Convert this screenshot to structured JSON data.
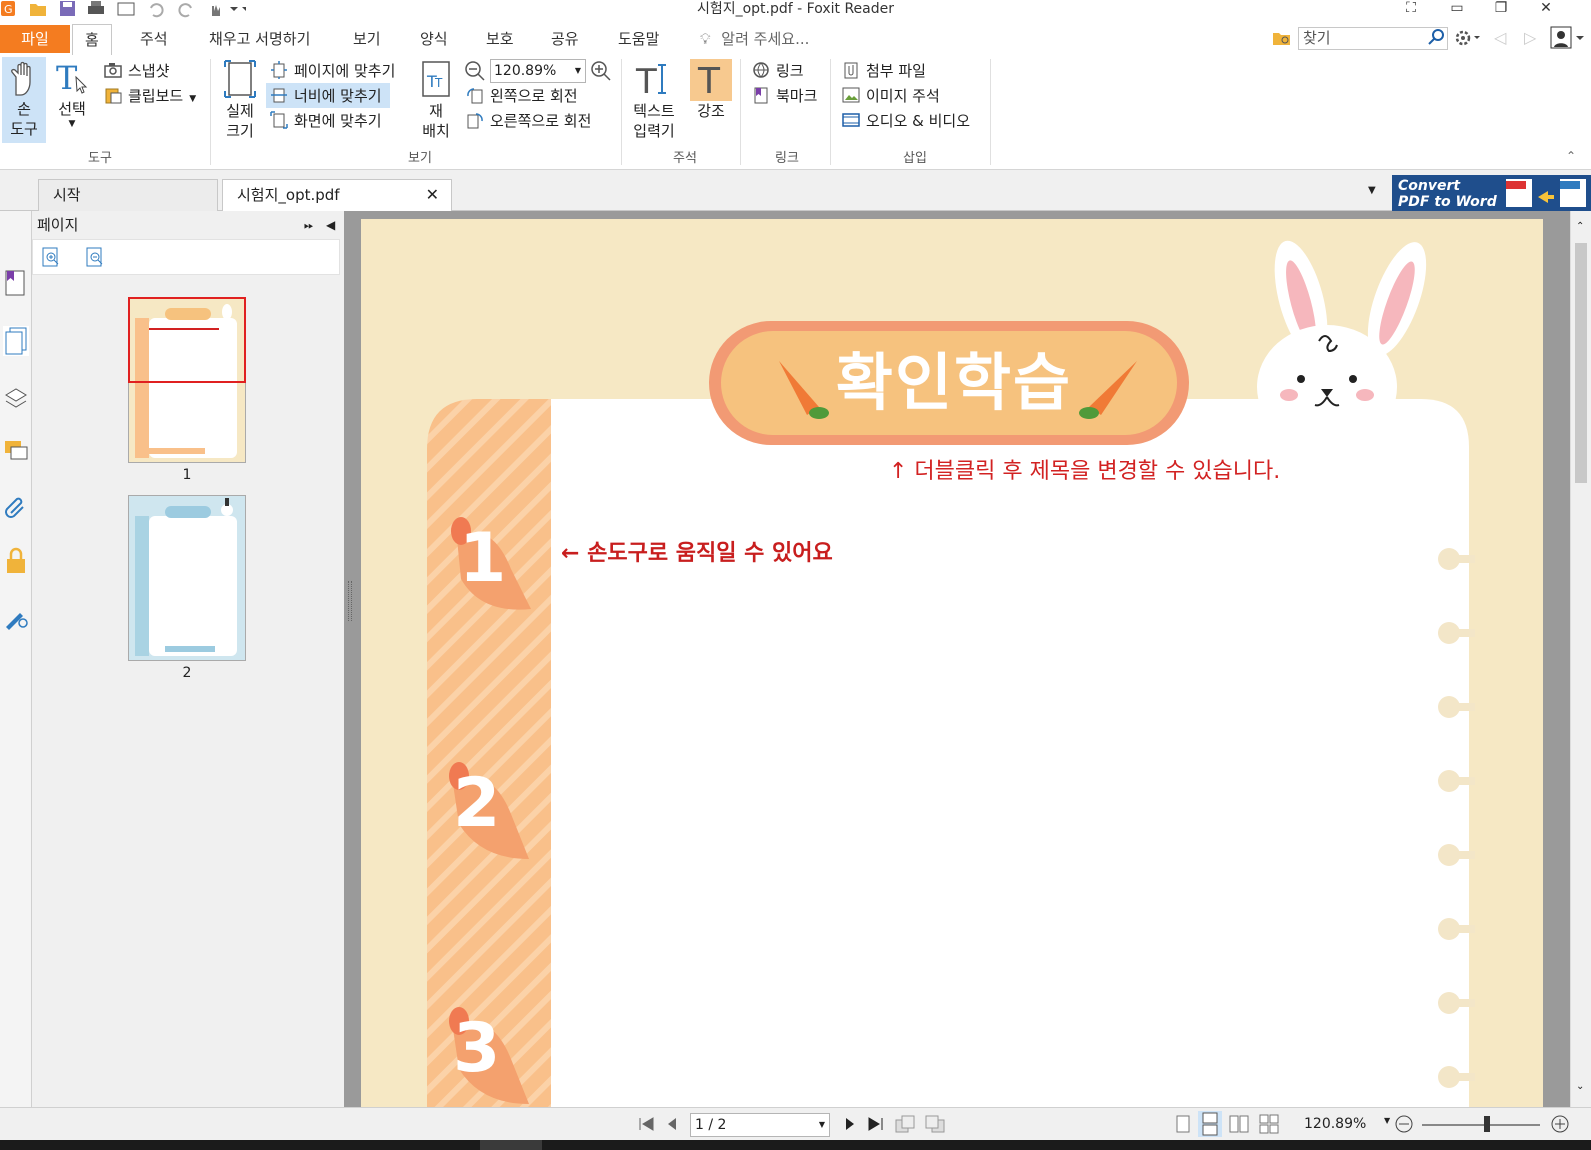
{
  "window": {
    "title": "시험지_opt.pdf - Foxit Reader"
  },
  "menu": {
    "file": "파일",
    "tabs": [
      "홈",
      "주석",
      "채우고 서명하기",
      "보기",
      "양식",
      "보호",
      "공유",
      "도움말"
    ],
    "tell_me": "알려 주세요...",
    "search_placeholder": "찾기"
  },
  "ribbon": {
    "tools": {
      "hand_line1": "손",
      "hand_line2": "도구",
      "select": "선택",
      "snapshot": "스냅샷",
      "clipboard": "클립보드",
      "group": "도구"
    },
    "view": {
      "actual_line1": "실제",
      "actual_line2": "크기",
      "fit_page": "페이지에 맞추기",
      "fit_width": "너비에 맞추기",
      "fit_visible": "화면에 맞추기",
      "reflow_line1": "재",
      "reflow_line2": "배치",
      "zoom_value": "120.89%",
      "rotate_left": "왼쪽으로 회전",
      "rotate_right": "오른쪽으로 회전",
      "group": "보기"
    },
    "comment": {
      "typewriter_line1": "텍스트",
      "typewriter_line2": "입력기",
      "highlight": "강조",
      "group": "주석"
    },
    "links": {
      "link": "링크",
      "bookmark": "북마크",
      "group": "링크"
    },
    "insert": {
      "attach": "첨부 파일",
      "image": "이미지 주석",
      "av": "오디오 & 비디오",
      "group": "삽입"
    }
  },
  "doc_tabs": {
    "start": "시작",
    "current": "시험지_opt.pdf"
  },
  "convert_ad": {
    "line1": "Convert",
    "line2": "PDF to Word"
  },
  "panel": {
    "title": "페이지",
    "pages": [
      "1",
      "2"
    ]
  },
  "document": {
    "heading": "확인학습",
    "hint_title": "↑  더블클릭 후 제목을 변경할 수 있습니다.",
    "hint_hand": "← 손도구로 움직일 수 있어요",
    "numbers": [
      "1",
      "2",
      "3"
    ]
  },
  "status": {
    "page_value": "1 / 2",
    "zoom": "120.89%"
  },
  "colors": {
    "file_tab": "#f47c20",
    "accent_blue": "#cde3f7",
    "page_bg": "#f6e8c4",
    "stripe": "#f9c08a",
    "title_pill": "#f6c27e",
    "hint_red": "#d22222"
  }
}
